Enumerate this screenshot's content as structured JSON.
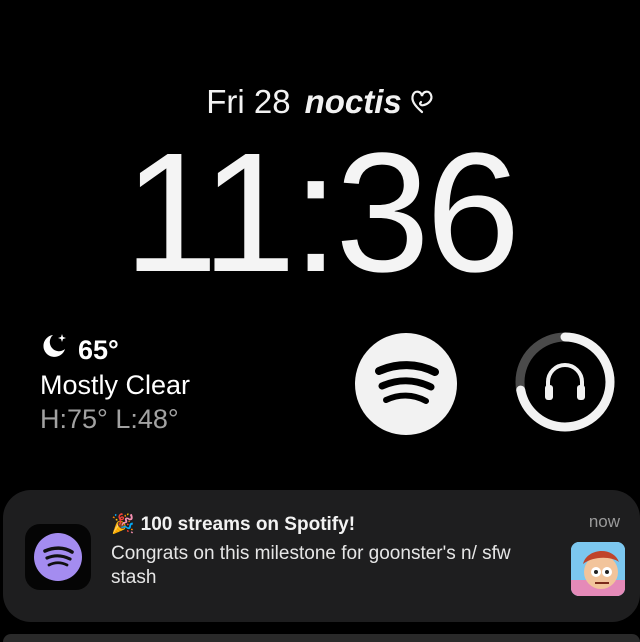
{
  "lockscreen": {
    "date": "Fri 28",
    "name": "noctis",
    "name_icon": "heart-outline-icon",
    "time": "11:36"
  },
  "weather": {
    "icon": "moon-stars-icon",
    "temp": "65°",
    "condition": "Mostly Clear",
    "hilo": "H:75° L:48°"
  },
  "widgets": {
    "spotify_icon": "spotify-logo-icon",
    "audio_icon": "headphones-icon",
    "audio_progress": 0.72
  },
  "notification": {
    "app_icon": "spotify-logo-icon",
    "title_emoji": "🎉",
    "title": "100 streams on Spotify!",
    "body": "Congrats on this milestone for goonster's n/ sfw stash",
    "time": "now",
    "thumbnail": "cartoon-character-thumbnail"
  },
  "colors": {
    "background": "#000000",
    "widget_white": "#f2f2f2",
    "notification_bg": "#1e1e1f",
    "spotify_lavender": "#a48cf0"
  }
}
